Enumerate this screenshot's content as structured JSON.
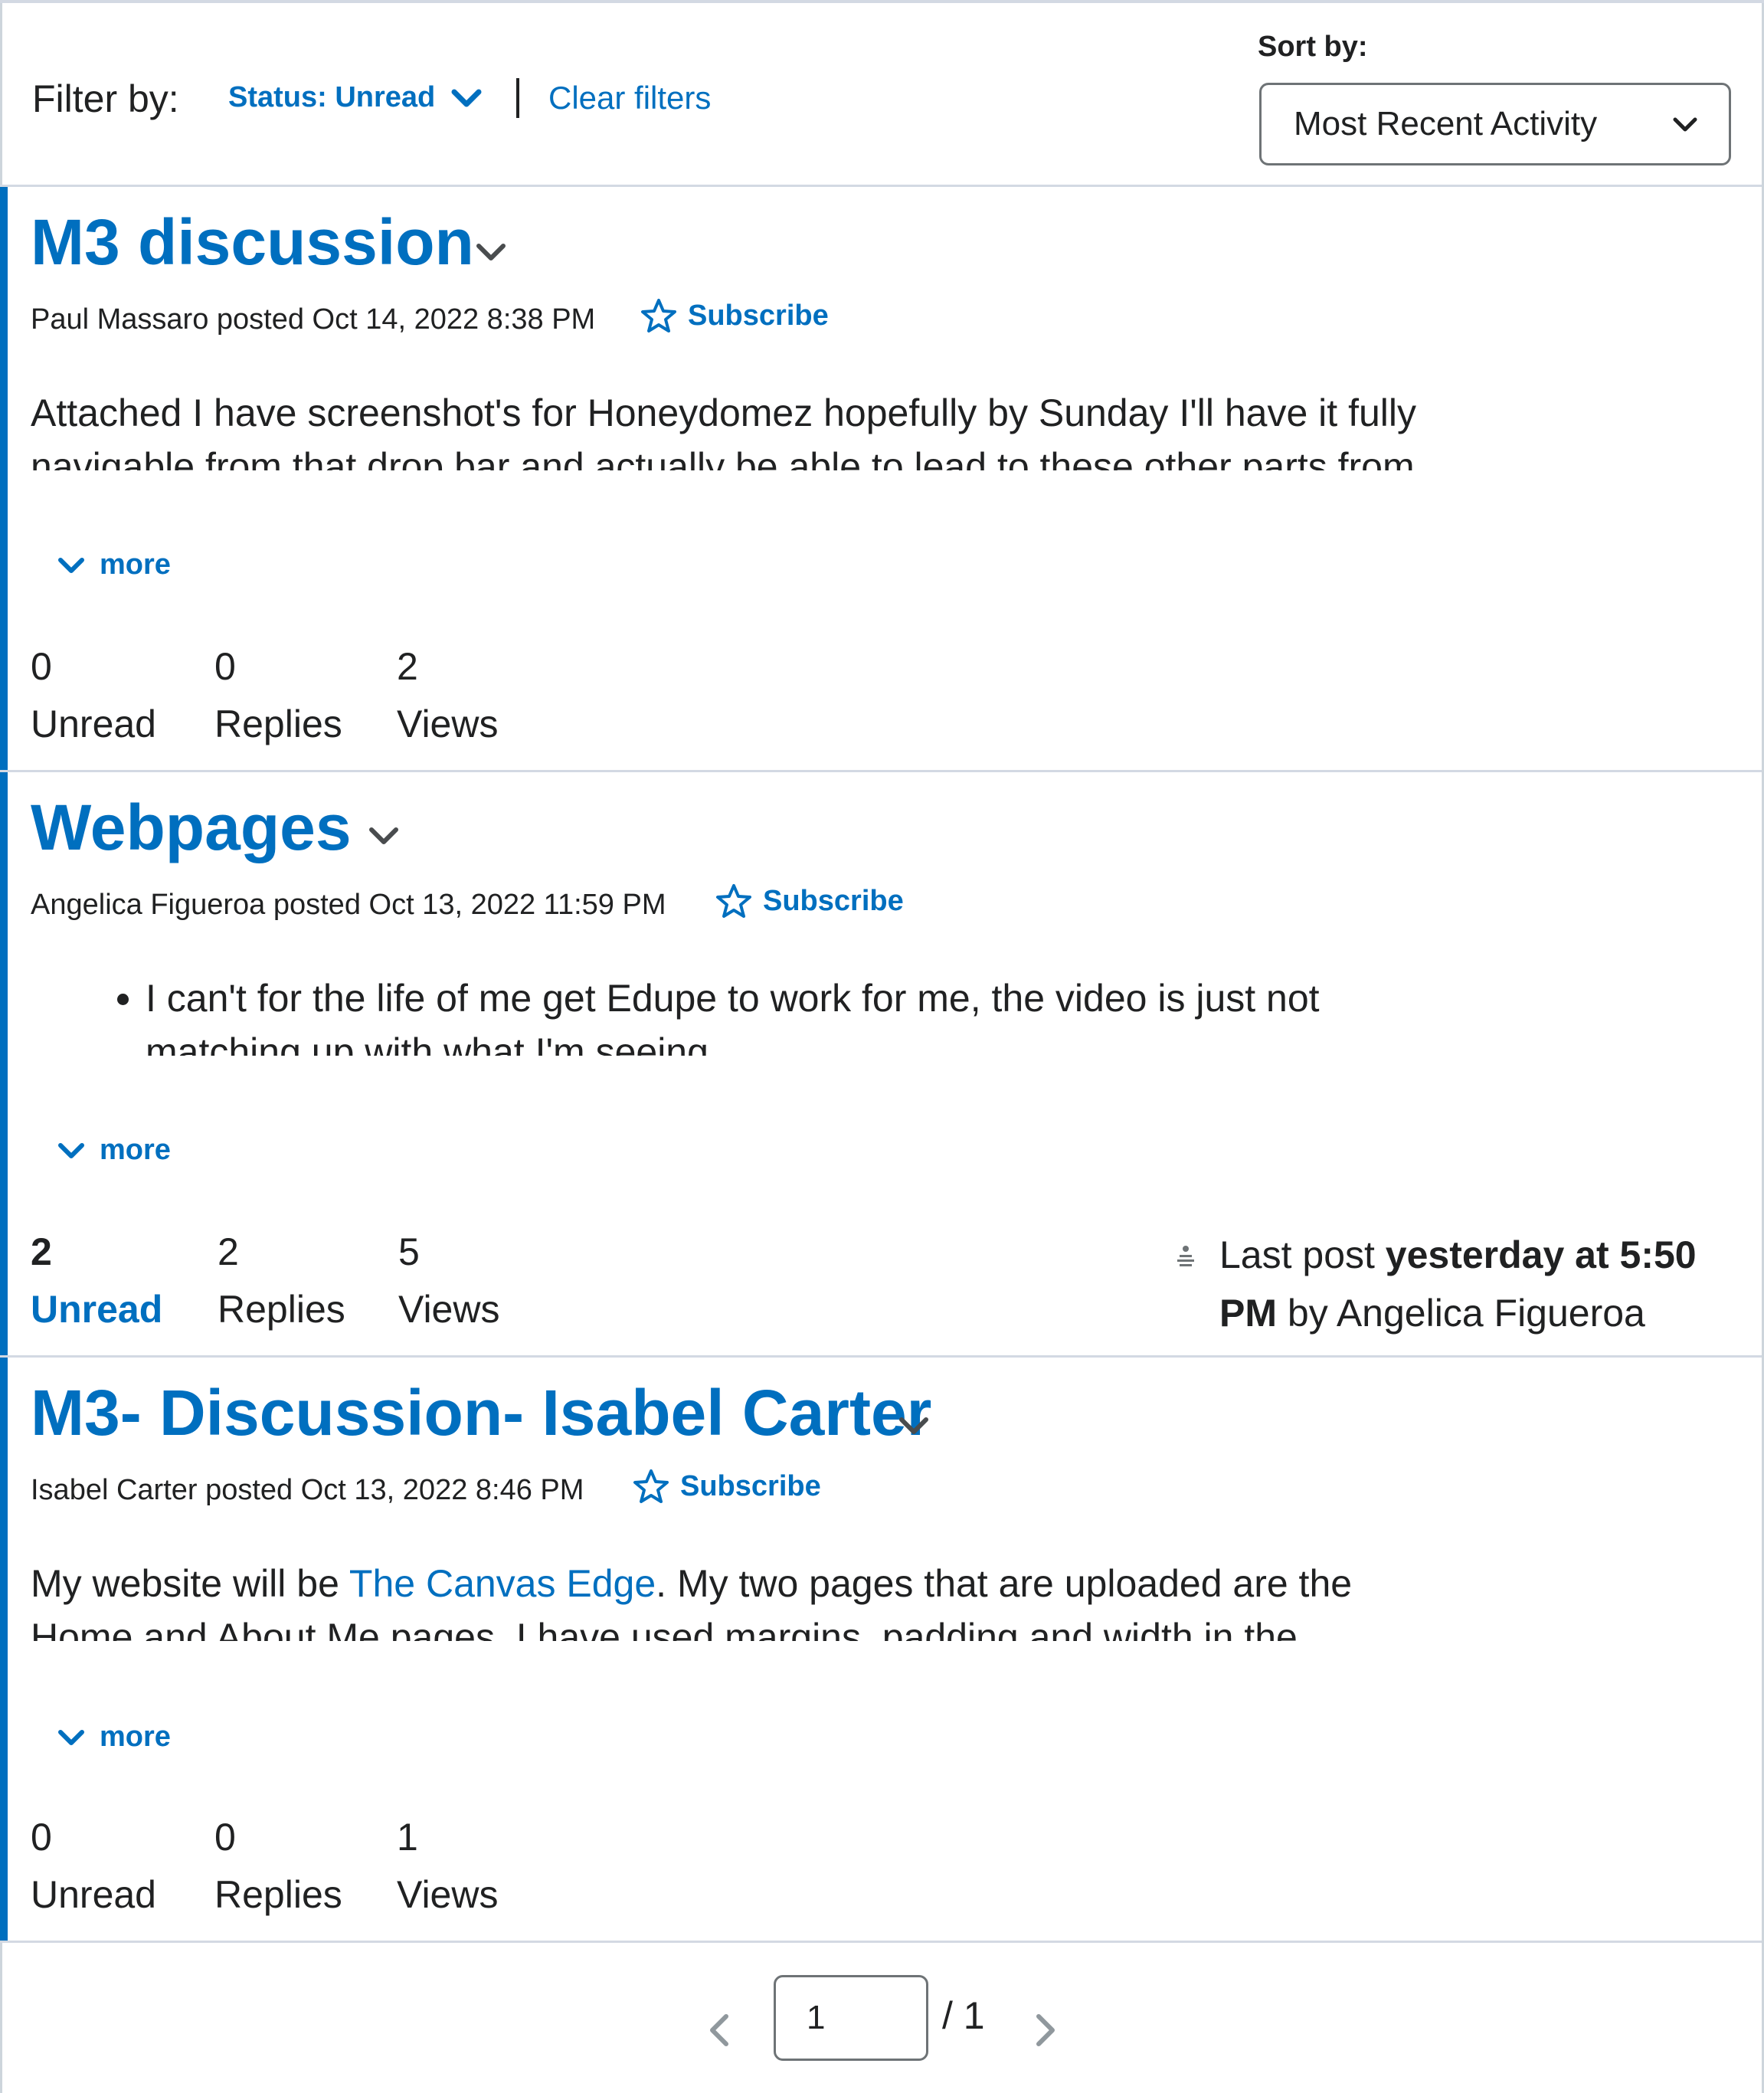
{
  "filters": {
    "label": "Filter by:",
    "status": "Status: Unread",
    "clear": "Clear filters"
  },
  "sort": {
    "label": "Sort by:",
    "selected": "Most Recent Activity"
  },
  "topics": [
    {
      "title": "M3 discussion",
      "meta": "Paul Massaro posted Oct 14, 2022 8:38 PM",
      "subscribe": "Subscribe",
      "excerpt_line1": "Attached I have screenshot's for Honeydomez hopefully by Sunday I'll have it fully",
      "excerpt_line2": "navigable from that drop bar and actually be able to lead to these other parts from",
      "more": "more",
      "stats": {
        "unread": "0",
        "unread_label": "Unread",
        "replies": "0",
        "replies_label": "Replies",
        "views": "2",
        "views_label": "Views"
      }
    },
    {
      "title": "Webpages",
      "meta": "Angelica Figueroa posted Oct 13, 2022 11:59 PM",
      "subscribe": "Subscribe",
      "excerpt_line1": "I can't for the life of me get Edupe to work for me, the video is just not",
      "excerpt_line2": "matching up with what I'm seeing",
      "more": "more",
      "stats": {
        "unread": "2",
        "unread_label": "Unread",
        "replies": "2",
        "replies_label": "Replies",
        "views": "5",
        "views_label": "Views"
      },
      "last_post": {
        "prefix": "Last post ",
        "when": "yesterday at 5:50 PM",
        "by": " by Angelica Figueroa"
      }
    },
    {
      "title": "M3- Discussion- Isabel Carter",
      "meta": "Isabel Carter posted Oct 13, 2022 8:46 PM",
      "subscribe": "Subscribe",
      "excerpt_pre": "My website will be ",
      "excerpt_link": "The Canvas Edge",
      "excerpt_post": ". My two pages that are uploaded are the",
      "excerpt_line2": "Home and About Me pages. I have used margins, padding and width in the",
      "more": "more",
      "stats": {
        "unread": "0",
        "unread_label": "Unread",
        "replies": "0",
        "replies_label": "Replies",
        "views": "1",
        "views_label": "Views"
      }
    }
  ],
  "pagination": {
    "current": "1",
    "total": "/ 1"
  }
}
